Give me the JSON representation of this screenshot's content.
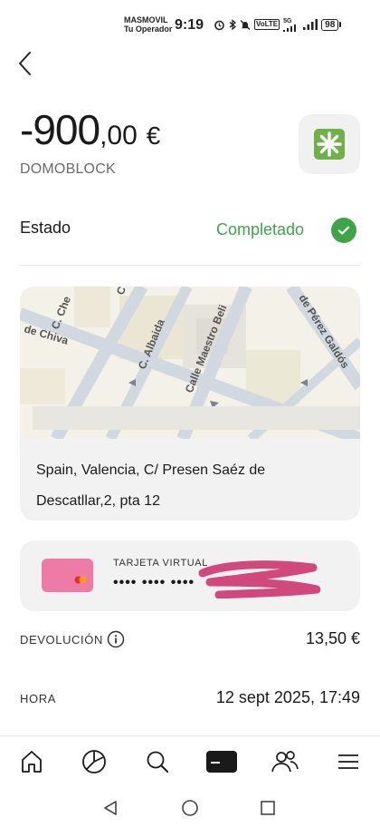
{
  "status_bar": {
    "carrier_name": "MASMOVIL",
    "carrier_sub": "Tu Operador",
    "time": "9:19",
    "volte": "VoLTE",
    "network": "5G",
    "battery": "98"
  },
  "header": {
    "amount_int": "-900",
    "amount_dec": ",00",
    "currency": "€",
    "merchant": "DOMOBLOCK"
  },
  "estado": {
    "label": "Estado",
    "value": "Completado",
    "color": "#3fa447"
  },
  "map": {
    "streets": [
      "C. Che",
      "de Chiva",
      "C. Albaida",
      "Calle Maestro Beli",
      "de Pérez Galdós",
      "C"
    ],
    "address": "Spain, Valencia, C/ Presen Saéz de Descatllar,2, pta 12"
  },
  "card": {
    "label": "TARJETA VIRTUAL",
    "number": "•••• •••• ••••",
    "color": "#ee7aa6"
  },
  "devolucion": {
    "label": "DEVOLUCIÓN",
    "value": "13,50 €"
  },
  "hora": {
    "label": "HORA",
    "value": "12 sept 2025, 17:49"
  },
  "nav": {
    "items": [
      "home-icon",
      "analytics-icon",
      "search-icon",
      "card-icon",
      "people-icon",
      "menu-icon"
    ],
    "active": "card-icon"
  }
}
